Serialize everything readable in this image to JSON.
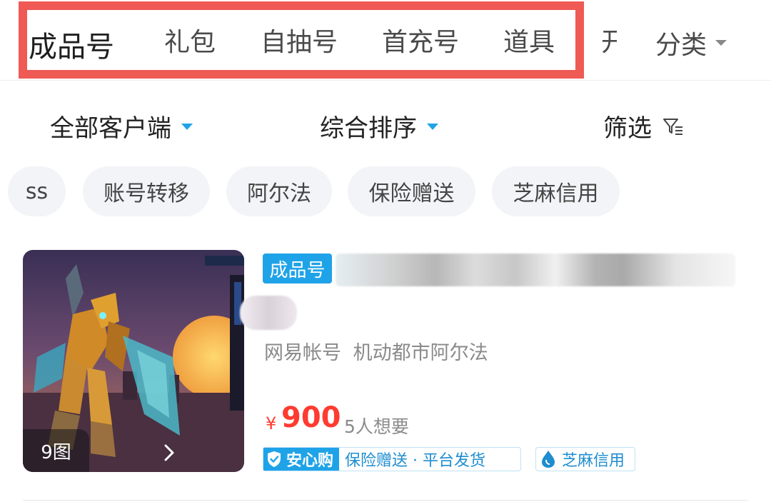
{
  "tabs": [
    {
      "label": "成品号",
      "active": true
    },
    {
      "label": "礼包"
    },
    {
      "label": "自抽号"
    },
    {
      "label": "首充号"
    },
    {
      "label": "道具"
    },
    {
      "label": "开"
    }
  ],
  "category": {
    "label": "分类"
  },
  "filters": {
    "client": "全部客户端",
    "sort": "综合排序",
    "filter": "筛选"
  },
  "chips": [
    "ss",
    "账号转移",
    "阿尔法",
    "保险赠送",
    "芝麻信用"
  ],
  "product": {
    "tag": "成品号",
    "image_count": "9图",
    "subtitle": "网易帐号 机动都市阿尔法",
    "price_symbol": "¥",
    "price": "900",
    "want": "5人想要",
    "assure_badge": "安心购",
    "assure_text": "保险赠送 · 平台发货",
    "zhima": "芝麻信用"
  },
  "colors": {
    "accent": "#1fa3e8",
    "price": "#ff3b30",
    "highlight_box": "#ef5a55"
  }
}
